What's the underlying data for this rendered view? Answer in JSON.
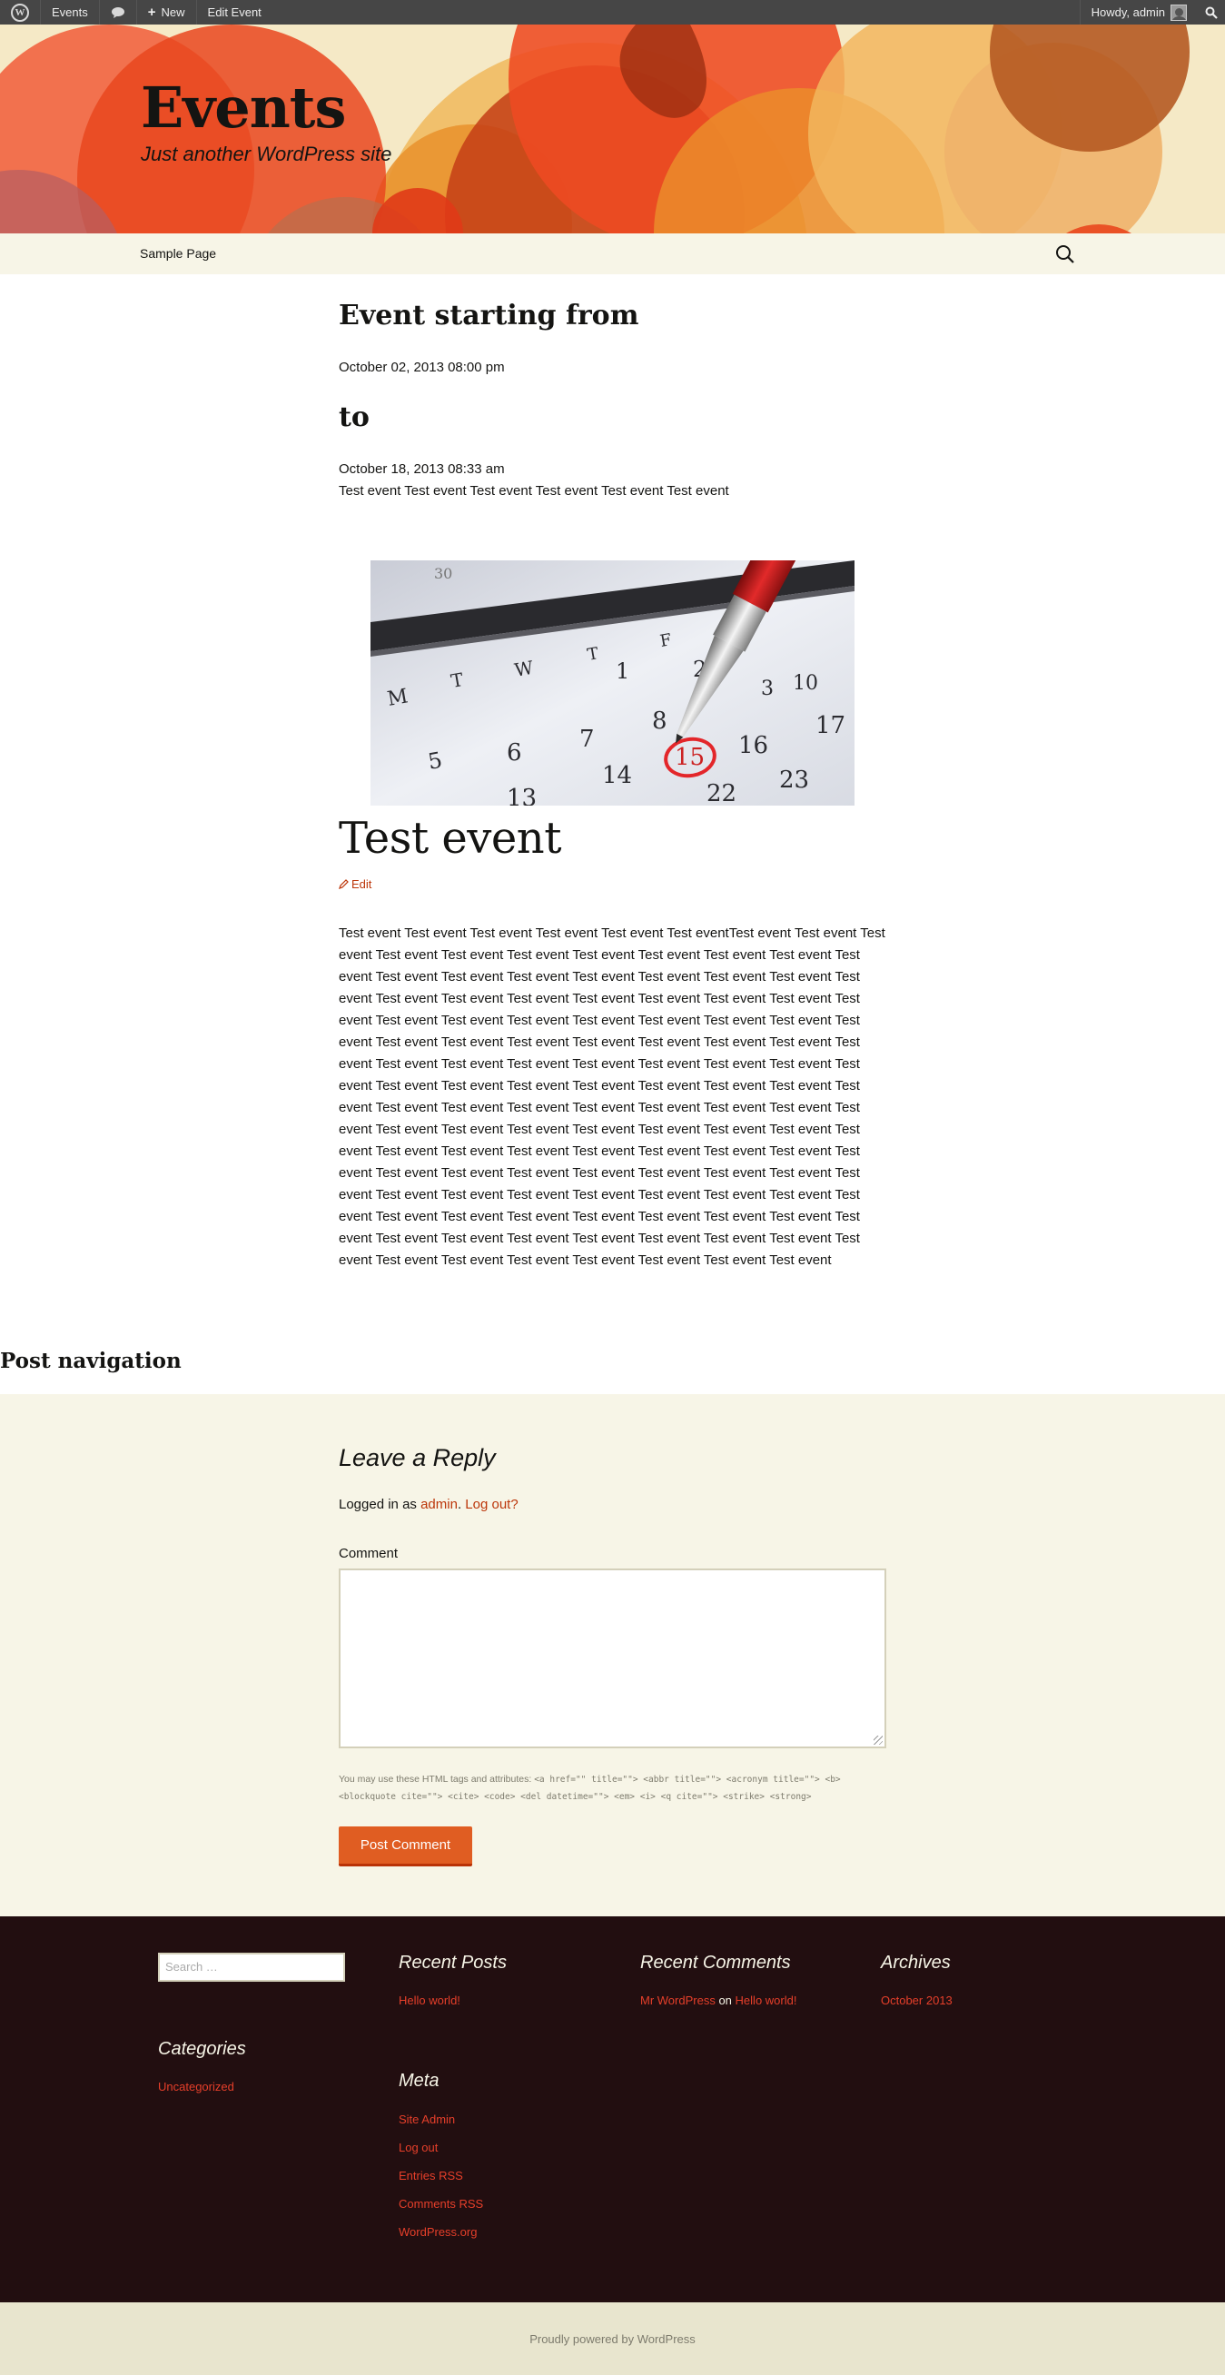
{
  "admin_bar": {
    "site_name": "Events",
    "new_label": "New",
    "edit_label": "Edit Event",
    "howdy": "Howdy, admin"
  },
  "header": {
    "title": "Events",
    "tagline": "Just another WordPress site",
    "colors": {
      "bg": "#f5e9c6",
      "accent": "#e05d22"
    }
  },
  "nav": {
    "items": [
      {
        "label": "Sample Page"
      }
    ]
  },
  "event": {
    "start_heading": "Event starting from",
    "start_date": "October 02, 2013 08:00 pm",
    "end_heading": "to",
    "end_date": "October 18, 2013 08:33 am",
    "short_description": "Test event Test event Test event Test event Test event Test event",
    "image_icon": "calendar-pen-photo"
  },
  "post": {
    "title": "Test event",
    "edit_label": "Edit",
    "lines": [
      "Test event Test event Test event Test event Test event Test eventTest event Test event Test",
      "event Test event Test event Test event Test event Test event Test event Test event Test",
      "event Test event Test event Test event Test event Test event Test event Test event Test",
      "event Test event Test event Test event Test event Test event Test event Test event Test",
      "event Test event Test event Test event Test event Test event Test event Test event Test",
      "event Test event Test event Test event Test event Test event Test event Test event Test",
      "event Test event Test event Test event Test event Test event Test event Test event Test",
      "event Test event Test event Test event Test event Test event Test event Test event Test",
      "event Test event Test event Test event Test event Test event Test event Test event Test",
      "event Test event Test event Test event Test event Test event Test event Test event Test",
      "event Test event Test event Test event Test event Test event Test event Test event Test",
      "event Test event Test event Test event Test event Test event Test event Test event Test",
      "event Test event Test event Test event Test event Test event Test event Test event Test",
      "event Test event Test event Test event Test event Test event Test event Test event Test",
      "event Test event Test event Test event Test event Test event Test event Test event Test",
      "event Test event Test event Test event Test event Test event Test event Test event"
    ]
  },
  "post_navigation": {
    "heading": "Post navigation"
  },
  "comments": {
    "reply_title": "Leave a Reply",
    "logged_in_prefix": "Logged in as ",
    "user": "admin",
    "logout": "Log out?",
    "comment_label": "Comment",
    "allowed_tags_intro": "You may use these HTML tags and attributes:",
    "allowed_tags_line1": "<a href=\"\" title=\"\"> <abbr title=\"\"> <acronym title=\"\"> <b>",
    "allowed_tags_line2": "<blockquote cite=\"\"> <cite> <code> <del datetime=\"\"> <em> <i> <q cite=\"\"> <strike> <strong>",
    "submit_label": "Post Comment"
  },
  "widgets": {
    "search_placeholder": "Search …",
    "recent_posts": {
      "title": "Recent Posts",
      "items": [
        "Hello world!"
      ]
    },
    "recent_comments": {
      "title": "Recent Comments",
      "author": "Mr WordPress",
      "on": "on",
      "post": "Hello world!"
    },
    "archives": {
      "title": "Archives",
      "items": [
        "October 2013"
      ]
    },
    "categories": {
      "title": "Categories",
      "items": [
        "Uncategorized"
      ]
    },
    "meta": {
      "title": "Meta",
      "items": [
        "Site Admin",
        "Log out",
        "Entries RSS",
        "Comments RSS",
        "WordPress.org"
      ]
    }
  },
  "footer": {
    "credit": "Proudly powered by WordPress"
  }
}
